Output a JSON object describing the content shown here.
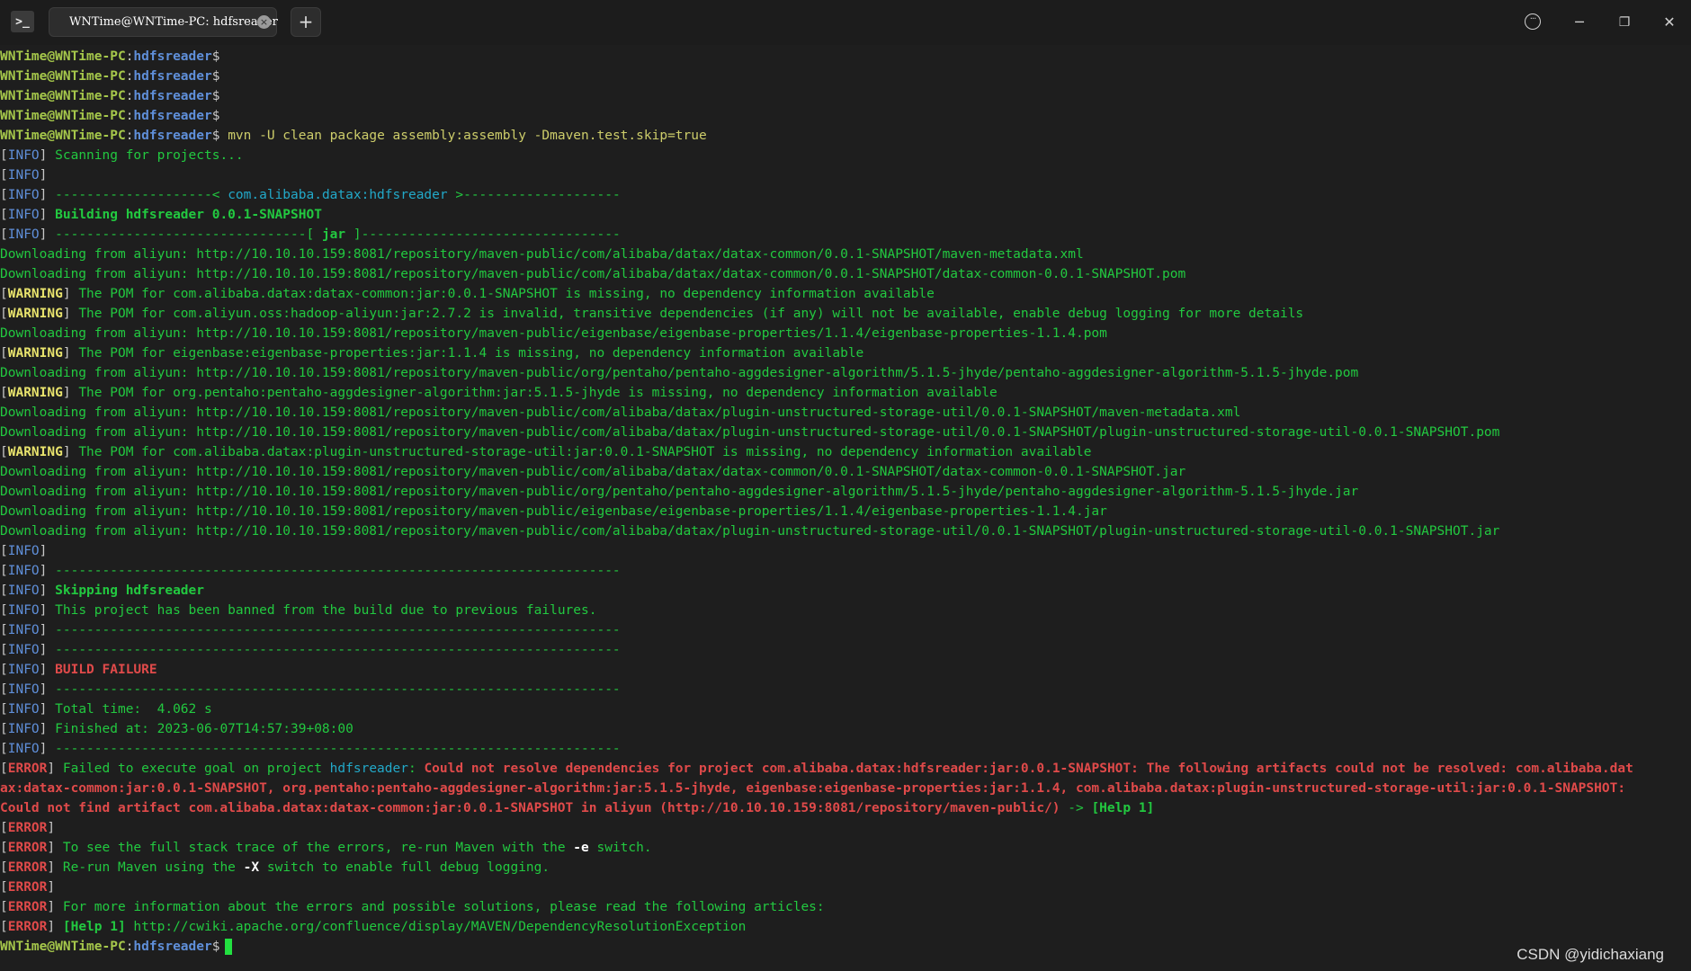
{
  "window": {
    "tab_title": "WNTime@WNTime-PC: hdfsreader",
    "app_icon": "terminal-icon",
    "tab_close_glyph": "×",
    "new_tab_glyph": "+",
    "more_glyph": "···",
    "minimize_glyph": "─",
    "restore_glyph": "❐",
    "close_glyph": "✕"
  },
  "terminal": {
    "lines": [
      [
        {
          "t": "WNTime@WNTime-PC",
          "c": "user"
        },
        {
          "t": ":",
          "c": "colon"
        },
        {
          "t": "hdfsreader",
          "c": "path"
        },
        {
          "t": "$",
          "c": "dollar"
        }
      ],
      [
        {
          "t": "WNTime@WNTime-PC",
          "c": "user"
        },
        {
          "t": ":",
          "c": "colon"
        },
        {
          "t": "hdfsreader",
          "c": "path"
        },
        {
          "t": "$",
          "c": "dollar"
        }
      ],
      [
        {
          "t": "WNTime@WNTime-PC",
          "c": "user"
        },
        {
          "t": ":",
          "c": "colon"
        },
        {
          "t": "hdfsreader",
          "c": "path"
        },
        {
          "t": "$",
          "c": "dollar"
        }
      ],
      [
        {
          "t": "WNTime@WNTime-PC",
          "c": "user"
        },
        {
          "t": ":",
          "c": "colon"
        },
        {
          "t": "hdfsreader",
          "c": "path"
        },
        {
          "t": "$",
          "c": "dollar"
        }
      ],
      [
        {
          "t": "WNTime@WNTime-PC",
          "c": "user"
        },
        {
          "t": ":",
          "c": "colon"
        },
        {
          "t": "hdfsreader",
          "c": "path"
        },
        {
          "t": "$",
          "c": "dollar"
        },
        {
          "t": " mvn -U clean package assembly:assembly -Dmaven.test.skip=true",
          "c": "cmd"
        }
      ],
      [
        {
          "t": "[",
          "c": "br"
        },
        {
          "t": "INFO",
          "c": "info"
        },
        {
          "t": "] ",
          "c": "br"
        },
        {
          "t": "Scanning for projects...",
          "c": "plain"
        }
      ],
      [
        {
          "t": "[",
          "c": "br"
        },
        {
          "t": "INFO",
          "c": "info"
        },
        {
          "t": "]",
          "c": "br"
        }
      ],
      [
        {
          "t": "[",
          "c": "br"
        },
        {
          "t": "INFO",
          "c": "info"
        },
        {
          "t": "] ",
          "c": "br"
        },
        {
          "t": "--------------------< ",
          "c": "plain"
        },
        {
          "t": "com.alibaba.datax:hdfsreader",
          "c": "cyan"
        },
        {
          "t": " >--------------------",
          "c": "plain"
        }
      ],
      [
        {
          "t": "[",
          "c": "br"
        },
        {
          "t": "INFO",
          "c": "info"
        },
        {
          "t": "] ",
          "c": "br"
        },
        {
          "t": "Building hdfsreader 0.0.1-SNAPSHOT",
          "c": "greenb"
        }
      ],
      [
        {
          "t": "[",
          "c": "br"
        },
        {
          "t": "INFO",
          "c": "info"
        },
        {
          "t": "] ",
          "c": "br"
        },
        {
          "t": "--------------------------------[ ",
          "c": "plain"
        },
        {
          "t": "jar",
          "c": "greenb"
        },
        {
          "t": " ]---------------------------------",
          "c": "plain"
        }
      ],
      [
        {
          "t": "Downloading from aliyun: http://10.10.10.159:8081/repository/maven-public/com/alibaba/datax/datax-common/0.0.1-SNAPSHOT/maven-metadata.xml",
          "c": "plain"
        }
      ],
      [
        {
          "t": "Downloading from aliyun: http://10.10.10.159:8081/repository/maven-public/com/alibaba/datax/datax-common/0.0.1-SNAPSHOT/datax-common-0.0.1-SNAPSHOT.pom",
          "c": "plain"
        }
      ],
      [
        {
          "t": "[",
          "c": "br"
        },
        {
          "t": "WARNING",
          "c": "warn"
        },
        {
          "t": "] ",
          "c": "br"
        },
        {
          "t": "The POM for com.alibaba.datax:datax-common:jar:0.0.1-SNAPSHOT is missing, no dependency information available",
          "c": "plain"
        }
      ],
      [
        {
          "t": "[",
          "c": "br"
        },
        {
          "t": "WARNING",
          "c": "warn"
        },
        {
          "t": "] ",
          "c": "br"
        },
        {
          "t": "The POM for com.aliyun.oss:hadoop-aliyun:jar:2.7.2 is invalid, transitive dependencies (if any) will not be available, enable debug logging for more details",
          "c": "plain"
        }
      ],
      [
        {
          "t": "Downloading from aliyun: http://10.10.10.159:8081/repository/maven-public/eigenbase/eigenbase-properties/1.1.4/eigenbase-properties-1.1.4.pom",
          "c": "plain"
        }
      ],
      [
        {
          "t": "[",
          "c": "br"
        },
        {
          "t": "WARNING",
          "c": "warn"
        },
        {
          "t": "] ",
          "c": "br"
        },
        {
          "t": "The POM for eigenbase:eigenbase-properties:jar:1.1.4 is missing, no dependency information available",
          "c": "plain"
        }
      ],
      [
        {
          "t": "Downloading from aliyun: http://10.10.10.159:8081/repository/maven-public/org/pentaho/pentaho-aggdesigner-algorithm/5.1.5-jhyde/pentaho-aggdesigner-algorithm-5.1.5-jhyde.pom",
          "c": "plain"
        }
      ],
      [
        {
          "t": "[",
          "c": "br"
        },
        {
          "t": "WARNING",
          "c": "warn"
        },
        {
          "t": "] ",
          "c": "br"
        },
        {
          "t": "The POM for org.pentaho:pentaho-aggdesigner-algorithm:jar:5.1.5-jhyde is missing, no dependency information available",
          "c": "plain"
        }
      ],
      [
        {
          "t": "Downloading from aliyun: http://10.10.10.159:8081/repository/maven-public/com/alibaba/datax/plugin-unstructured-storage-util/0.0.1-SNAPSHOT/maven-metadata.xml",
          "c": "plain"
        }
      ],
      [
        {
          "t": "Downloading from aliyun: http://10.10.10.159:8081/repository/maven-public/com/alibaba/datax/plugin-unstructured-storage-util/0.0.1-SNAPSHOT/plugin-unstructured-storage-util-0.0.1-SNAPSHOT.pom",
          "c": "plain"
        }
      ],
      [
        {
          "t": "[",
          "c": "br"
        },
        {
          "t": "WARNING",
          "c": "warn"
        },
        {
          "t": "] ",
          "c": "br"
        },
        {
          "t": "The POM for com.alibaba.datax:plugin-unstructured-storage-util:jar:0.0.1-SNAPSHOT is missing, no dependency information available",
          "c": "plain"
        }
      ],
      [
        {
          "t": "Downloading from aliyun: http://10.10.10.159:8081/repository/maven-public/com/alibaba/datax/datax-common/0.0.1-SNAPSHOT/datax-common-0.0.1-SNAPSHOT.jar",
          "c": "plain"
        }
      ],
      [
        {
          "t": "Downloading from aliyun: http://10.10.10.159:8081/repository/maven-public/org/pentaho/pentaho-aggdesigner-algorithm/5.1.5-jhyde/pentaho-aggdesigner-algorithm-5.1.5-jhyde.jar",
          "c": "plain"
        }
      ],
      [
        {
          "t": "Downloading from aliyun: http://10.10.10.159:8081/repository/maven-public/eigenbase/eigenbase-properties/1.1.4/eigenbase-properties-1.1.4.jar",
          "c": "plain"
        }
      ],
      [
        {
          "t": "Downloading from aliyun: http://10.10.10.159:8081/repository/maven-public/com/alibaba/datax/plugin-unstructured-storage-util/0.0.1-SNAPSHOT/plugin-unstructured-storage-util-0.0.1-SNAPSHOT.jar",
          "c": "plain"
        }
      ],
      [
        {
          "t": "[",
          "c": "br"
        },
        {
          "t": "INFO",
          "c": "info"
        },
        {
          "t": "]",
          "c": "br"
        }
      ],
      [
        {
          "t": "[",
          "c": "br"
        },
        {
          "t": "INFO",
          "c": "info"
        },
        {
          "t": "] ",
          "c": "br"
        },
        {
          "t": "------------------------------------------------------------------------",
          "c": "plain"
        }
      ],
      [
        {
          "t": "[",
          "c": "br"
        },
        {
          "t": "INFO",
          "c": "info"
        },
        {
          "t": "] ",
          "c": "br"
        },
        {
          "t": "Skipping hdfsreader",
          "c": "greenb"
        }
      ],
      [
        {
          "t": "[",
          "c": "br"
        },
        {
          "t": "INFO",
          "c": "info"
        },
        {
          "t": "] ",
          "c": "br"
        },
        {
          "t": "This project has been banned from the build due to previous failures.",
          "c": "plain"
        }
      ],
      [
        {
          "t": "[",
          "c": "br"
        },
        {
          "t": "INFO",
          "c": "info"
        },
        {
          "t": "] ",
          "c": "br"
        },
        {
          "t": "------------------------------------------------------------------------",
          "c": "plain"
        }
      ],
      [
        {
          "t": "[",
          "c": "br"
        },
        {
          "t": "INFO",
          "c": "info"
        },
        {
          "t": "] ",
          "c": "br"
        },
        {
          "t": "------------------------------------------------------------------------",
          "c": "plain"
        }
      ],
      [
        {
          "t": "[",
          "c": "br"
        },
        {
          "t": "INFO",
          "c": "info"
        },
        {
          "t": "] ",
          "c": "br"
        },
        {
          "t": "BUILD FAILURE",
          "c": "redb"
        }
      ],
      [
        {
          "t": "[",
          "c": "br"
        },
        {
          "t": "INFO",
          "c": "info"
        },
        {
          "t": "] ",
          "c": "br"
        },
        {
          "t": "------------------------------------------------------------------------",
          "c": "plain"
        }
      ],
      [
        {
          "t": "[",
          "c": "br"
        },
        {
          "t": "INFO",
          "c": "info"
        },
        {
          "t": "] ",
          "c": "br"
        },
        {
          "t": "Total time:  4.062 s",
          "c": "plain"
        }
      ],
      [
        {
          "t": "[",
          "c": "br"
        },
        {
          "t": "INFO",
          "c": "info"
        },
        {
          "t": "] ",
          "c": "br"
        },
        {
          "t": "Finished at: 2023-06-07T14:57:39+08:00",
          "c": "plain"
        }
      ],
      [
        {
          "t": "[",
          "c": "br"
        },
        {
          "t": "INFO",
          "c": "info"
        },
        {
          "t": "] ",
          "c": "br"
        },
        {
          "t": "------------------------------------------------------------------------",
          "c": "plain"
        }
      ],
      [
        {
          "t": "[",
          "c": "br"
        },
        {
          "t": "ERROR",
          "c": "error"
        },
        {
          "t": "] ",
          "c": "br"
        },
        {
          "t": "Failed to execute goal on project ",
          "c": "plain"
        },
        {
          "t": "hdfsreader",
          "c": "cyan"
        },
        {
          "t": ": ",
          "c": "plain"
        },
        {
          "t": "Could not resolve dependencies for project com.alibaba.datax:hdfsreader:jar:0.0.1-SNAPSHOT: The following artifacts could not be resolved: com.alibaba.dat",
          "c": "redb"
        }
      ],
      [
        {
          "t": "ax:datax-common:jar:0.0.1-SNAPSHOT, org.pentaho:pentaho-aggdesigner-algorithm:jar:5.1.5-jhyde, eigenbase:eigenbase-properties:jar:1.1.4, com.alibaba.datax:plugin-unstructured-storage-util:jar:0.0.1-SNAPSHOT:",
          "c": "redb"
        }
      ],
      [
        {
          "t": "Could not find artifact com.alibaba.datax:datax-common:jar:0.0.1-SNAPSHOT in aliyun (http://10.10.10.159:8081/repository/maven-public/)",
          "c": "redb"
        },
        {
          "t": " -> ",
          "c": "plain"
        },
        {
          "t": "[Help 1]",
          "c": "greenb"
        }
      ],
      [
        {
          "t": "[",
          "c": "br"
        },
        {
          "t": "ERROR",
          "c": "error"
        },
        {
          "t": "]",
          "c": "br"
        }
      ],
      [
        {
          "t": "[",
          "c": "br"
        },
        {
          "t": "ERROR",
          "c": "error"
        },
        {
          "t": "] ",
          "c": "br"
        },
        {
          "t": "To see the full stack trace of the errors, re-run Maven with the ",
          "c": "plain"
        },
        {
          "t": "-e",
          "c": "whiteb"
        },
        {
          "t": " switch.",
          "c": "plain"
        }
      ],
      [
        {
          "t": "[",
          "c": "br"
        },
        {
          "t": "ERROR",
          "c": "error"
        },
        {
          "t": "] ",
          "c": "br"
        },
        {
          "t": "Re-run Maven using the ",
          "c": "plain"
        },
        {
          "t": "-X",
          "c": "whiteb"
        },
        {
          "t": " switch to enable full debug logging.",
          "c": "plain"
        }
      ],
      [
        {
          "t": "[",
          "c": "br"
        },
        {
          "t": "ERROR",
          "c": "error"
        },
        {
          "t": "]",
          "c": "br"
        }
      ],
      [
        {
          "t": "[",
          "c": "br"
        },
        {
          "t": "ERROR",
          "c": "error"
        },
        {
          "t": "] ",
          "c": "br"
        },
        {
          "t": "For more information about the errors and possible solutions, please read the following articles:",
          "c": "plain"
        }
      ],
      [
        {
          "t": "[",
          "c": "br"
        },
        {
          "t": "ERROR",
          "c": "error"
        },
        {
          "t": "] ",
          "c": "br"
        },
        {
          "t": "[Help 1]",
          "c": "greenb"
        },
        {
          "t": " http://cwiki.apache.org/confluence/display/MAVEN/DependencyResolutionException",
          "c": "plain"
        }
      ],
      [
        {
          "t": "WNTime@WNTime-PC",
          "c": "user"
        },
        {
          "t": ":",
          "c": "colon"
        },
        {
          "t": "hdfsreader",
          "c": "path"
        },
        {
          "t": "$",
          "c": "dollar"
        }
      ]
    ]
  },
  "watermark": "CSDN @yidichaxiang"
}
